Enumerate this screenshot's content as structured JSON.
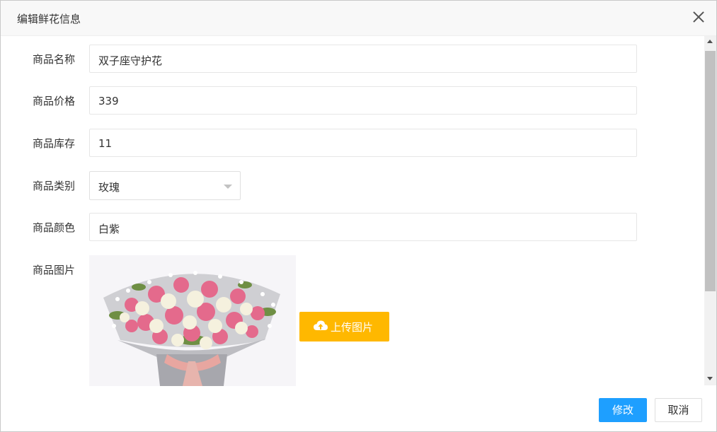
{
  "dialog": {
    "title": "编辑鲜花信息"
  },
  "form": {
    "name": {
      "label": "商品名称",
      "value": "双子座守护花"
    },
    "price": {
      "label": "商品价格",
      "value": "339"
    },
    "stock": {
      "label": "商品库存",
      "value": "11"
    },
    "category": {
      "label": "商品类别",
      "value": "玫瑰"
    },
    "color": {
      "label": "商品颜色",
      "value": "白紫"
    },
    "image": {
      "label": "商品图片",
      "upload_label": "上传图片"
    }
  },
  "footer": {
    "submit_label": "修改",
    "cancel_label": "取消"
  },
  "colors": {
    "primary": "#1e9fff",
    "upload": "#ffb800"
  }
}
